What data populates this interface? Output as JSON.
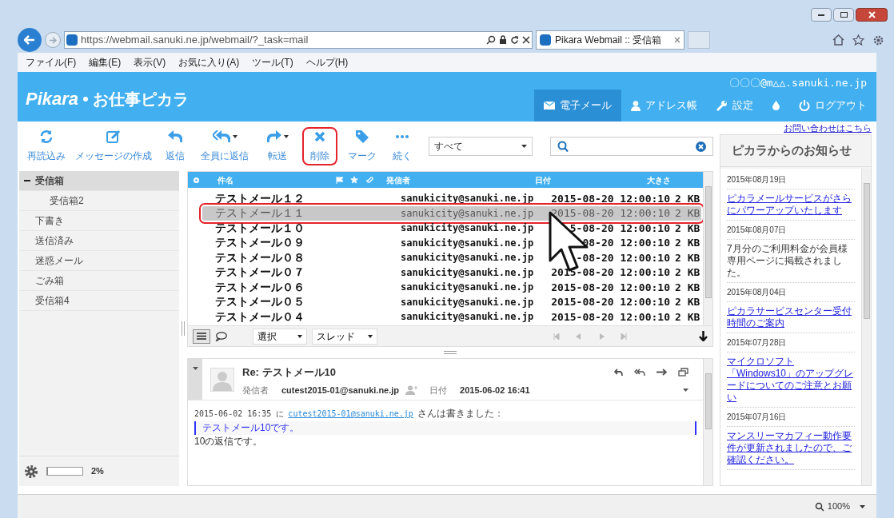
{
  "browser": {
    "address": "https://webmail.sanuki.ne.jp/webmail/?_task=mail",
    "tab_title": "Pikara Webmail :: 受信箱",
    "menu": [
      "ファイル(F)",
      "編集(E)",
      "表示(V)",
      "お気に入り(A)",
      "ツール(T)",
      "ヘルプ(H)"
    ],
    "zoom": "100%"
  },
  "header": {
    "logo": "Pikara",
    "logo_sub": "お仕事ピカラ",
    "account": "〇〇〇@m△△.sanuki.ne.jp",
    "nav": [
      {
        "kind": "mail",
        "label": "電子メール",
        "selected": true
      },
      {
        "kind": "contacts",
        "label": "アドレス帳",
        "selected": false
      },
      {
        "kind": "settings",
        "label": "設定",
        "selected": false
      },
      {
        "kind": "drop",
        "selected": false
      },
      {
        "kind": "logout",
        "label": "ログアウト",
        "selected": false
      }
    ]
  },
  "contact_link": "お問い合わせはこちら",
  "toolbar": [
    {
      "kind": "reload",
      "label": "再読込み",
      "highlighted": false
    },
    {
      "kind": "compose",
      "label": "メッセージの作成",
      "highlighted": false
    },
    {
      "kind": "reply",
      "label": "返信",
      "highlighted": false
    },
    {
      "kind": "reply-all",
      "label": "全員に返信",
      "has_menu": true,
      "highlighted": false
    },
    {
      "kind": "forward",
      "label": "転送",
      "has_menu": true,
      "highlighted": false
    },
    {
      "kind": "delete",
      "label": "削除",
      "highlighted": true
    },
    {
      "kind": "mark",
      "label": "マーク",
      "highlighted": false
    },
    {
      "kind": "more",
      "label": "続く",
      "highlighted": false
    }
  ],
  "filter": "すべて",
  "folders": [
    {
      "label": "受信箱",
      "selected": true,
      "expanded": true,
      "children": [
        {
          "label": "受信箱2",
          "selected": false
        }
      ]
    },
    {
      "label": "下書き",
      "selected": false
    },
    {
      "label": "送信済み",
      "selected": false
    },
    {
      "label": "迷惑メール",
      "selected": false
    },
    {
      "label": "ごみ箱",
      "selected": false
    },
    {
      "label": "受信箱4",
      "selected": false
    }
  ],
  "quota": {
    "level": 0.02,
    "reading": "2%"
  },
  "list": {
    "columns": [
      "件名",
      "発信者",
      "日付",
      "大きさ"
    ],
    "rows": [
      {
        "subject": "テストメール１２",
        "from": "sanukicity@sanuki.ne.jp",
        "date": "2015-08-20 12:00:10",
        "size": "2 KB",
        "selected": false,
        "highlighted": false
      },
      {
        "subject": "テストメール１１",
        "from": "sanukicity@sanuki.ne.jp",
        "date": "2015-08-20 12:00:10",
        "size": "2 KB",
        "selected": true,
        "highlighted": true
      },
      {
        "subject": "テストメール１０",
        "from": "sanukicity@sanuki.ne.jp",
        "date": "5-08-20 12:00:10",
        "size": "2 KB",
        "selected": false,
        "highlighted": false
      },
      {
        "subject": "テストメール０９",
        "from": "sanukicity@sanuki.ne.jp",
        "date": "08-20 12:00:10",
        "size": "2 KB",
        "selected": false,
        "highlighted": false
      },
      {
        "subject": "テストメール０８",
        "from": "sanukicity@sanuki.ne.jp",
        "date": "-08-20 12:00:10",
        "size": "2 KB",
        "selected": false,
        "highlighted": false
      },
      {
        "subject": "テストメール０７",
        "from": "sanukicity@sanuki.ne.jp",
        "date": "2015-08-20 12:00:10",
        "size": "2 KB",
        "selected": false,
        "highlighted": false
      },
      {
        "subject": "テストメール０６",
        "from": "sanukicity@sanuki.ne.jp",
        "date": "2015-08-20 12:00:10",
        "size": "2 KB",
        "selected": false,
        "highlighted": false
      },
      {
        "subject": "テストメール０５",
        "from": "sanukicity@sanuki.ne.jp",
        "date": "2015-08-20 12:00:10",
        "size": "2 KB",
        "selected": false,
        "highlighted": false
      },
      {
        "subject": "テストメール０４",
        "from": "sanukicity@sanuki.ne.jp",
        "date": "2015-08-20 12:00:10",
        "size": "2 KB",
        "selected": false,
        "highlighted": false
      }
    ],
    "select": "選択",
    "threads": "スレッド"
  },
  "preview": {
    "subject": "Re: テストメール10",
    "from_label": "発信者",
    "from": "cutest2015-01@sanuki.ne.jp",
    "date_label": "日付",
    "date": "2015-06-02 16:41",
    "intro_before": "2015-06-02 16:35 に",
    "intro_link": "cutest2015-01@sanuki.ne.jp",
    "intro_after": "さんは書きました：",
    "quote": "テストメール10です。",
    "body": "10の返信です。"
  },
  "news": {
    "title": "ピカラからのお知らせ",
    "items": [
      {
        "kind": "date",
        "text": "2015年08月19日"
      },
      {
        "kind": "link",
        "text": "ピカラメールサービスがさらにパワーアップいたします"
      },
      {
        "kind": "date",
        "text": "2015年08月07日"
      },
      {
        "kind": "text",
        "text": "7月分のご利用料金が会員様専用ページに掲載されました。"
      },
      {
        "kind": "date",
        "text": "2015年08月04日"
      },
      {
        "kind": "link",
        "text": "ピカラサービスセンター受付時間のご案内"
      },
      {
        "kind": "date",
        "text": "2015年07月28日"
      },
      {
        "kind": "link",
        "text": "マイクロソフト「Windows10」のアップグレードについてのご注意とお願い"
      },
      {
        "kind": "date",
        "text": "2015年07月16日"
      },
      {
        "kind": "link",
        "text": "マンスリーマカフィー動作要件が更新されましたので、ご確認ください。"
      }
    ]
  }
}
